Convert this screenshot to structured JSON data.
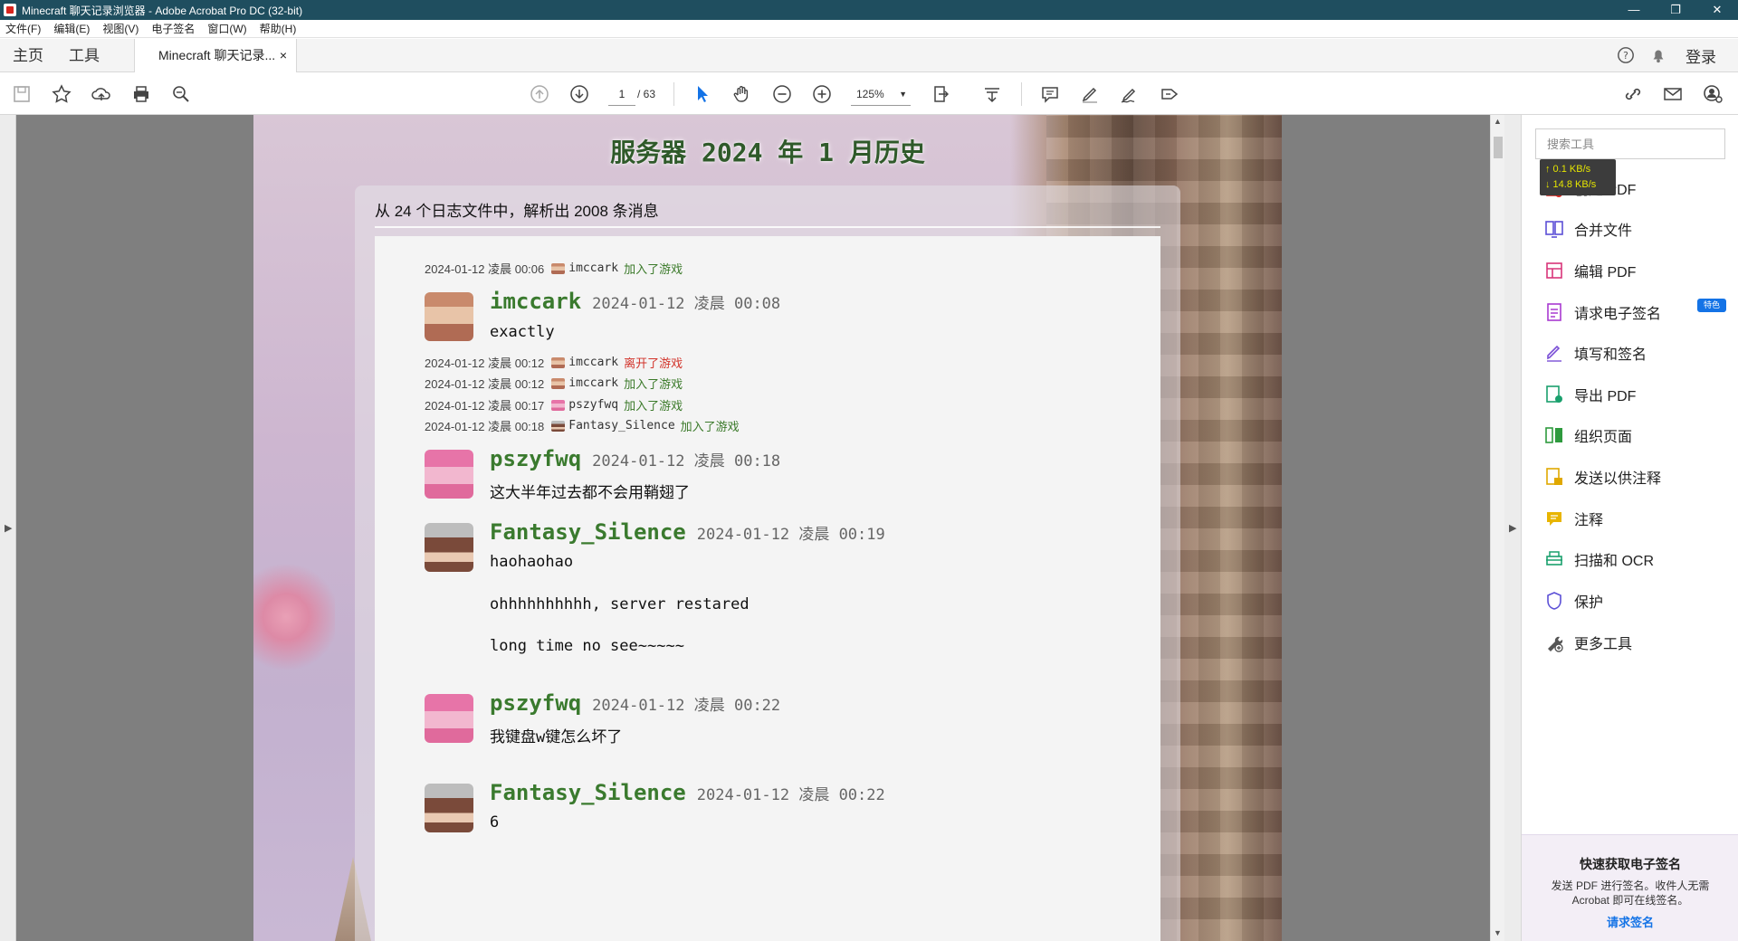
{
  "window": {
    "title": "Minecraft 聊天记录浏览器 - Adobe Acrobat Pro DC (32-bit)",
    "minimize": "—",
    "maximize": "❐",
    "close": "✕"
  },
  "menu": [
    "文件(F)",
    "编辑(E)",
    "视图(V)",
    "电子签名",
    "窗口(W)",
    "帮助(H)"
  ],
  "tabs": {
    "home": "主页",
    "tools": "工具",
    "document": "Minecraft 聊天记录...",
    "close": "×",
    "login": "登录"
  },
  "toolbar": {
    "page_current": "1",
    "page_total": "/ 63",
    "zoom": "125%"
  },
  "page": {
    "title": "服务器 2024 年 1 月历史",
    "summary": "从 24 个日志文件中，解析出 2008 条消息"
  },
  "events": [
    {
      "time": "2024-01-12 凌晨 00:06",
      "user": "imccark",
      "action": "加入了游戏"
    },
    {
      "time": "2024-01-12 凌晨 00:12",
      "user": "imccark",
      "action": "离开了游戏"
    },
    {
      "time": "2024-01-12 凌晨 00:12",
      "user": "imccark",
      "action": "加入了游戏"
    },
    {
      "time": "2024-01-12 凌晨 00:17",
      "user": "pszyfwq",
      "action": "加入了游戏"
    },
    {
      "time": "2024-01-12 凌晨 00:18",
      "user": "Fantasy_Silence",
      "action": "加入了游戏"
    }
  ],
  "messages": [
    {
      "user": "imccark",
      "time": "2024-01-12 凌晨 00:08",
      "lines": [
        "exactly"
      ]
    },
    {
      "user": "pszyfwq",
      "time": "2024-01-12 凌晨 00:18",
      "lines": [
        "这大半年过去都不会用鞘翅了"
      ]
    },
    {
      "user": "Fantasy_Silence",
      "time": "2024-01-12 凌晨 00:19",
      "lines": [
        "haohaohao",
        "ohhhhhhhhhh, server restared",
        "long time no see~~~~~"
      ]
    },
    {
      "user": "pszyfwq",
      "time": "2024-01-12 凌晨 00:22",
      "lines": [
        "我键盘w键怎么坏了"
      ]
    },
    {
      "user": "Fantasy_Silence",
      "time": "2024-01-12 凌晨 00:22",
      "lines": [
        "6"
      ]
    }
  ],
  "tools_pane": {
    "search_placeholder": "搜索工具",
    "net_up": "↑ 0.1 KB/s",
    "net_down": "↓ 14.8 KB/s",
    "items": [
      "创建 PDF",
      "合并文件",
      "编辑 PDF",
      "请求电子签名",
      "填写和签名",
      "导出 PDF",
      "组织页面",
      "发送以供注释",
      "注释",
      "扫描和 OCR",
      "保护",
      "更多工具"
    ],
    "featured_badge": "特色",
    "promo_title": "快速获取电子签名",
    "promo_desc": "发送 PDF 进行签名。收件人无需 Acrobat 即可在线签名。",
    "promo_link": "请求签名"
  },
  "colors": {
    "titlebar": "#1f4e5f",
    "username": "#3a7a2e",
    "join": "#3b7a2a",
    "leave": "#d2342b",
    "accent": "#1473e6"
  }
}
